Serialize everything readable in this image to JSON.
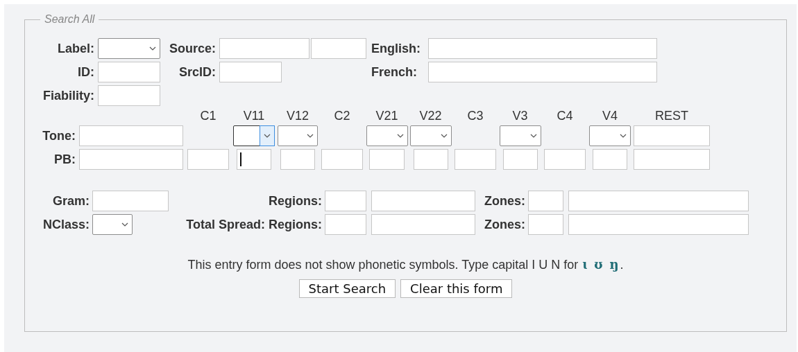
{
  "fieldset": {
    "legend": "Search All"
  },
  "top_rows": [
    {
      "groups": [
        {
          "label": "Label:",
          "fields": [
            {
              "kind": "select",
              "focused": false
            }
          ]
        },
        {
          "label": "Source:",
          "fields": [
            {
              "kind": "text",
              "focused": false
            },
            {
              "kind": "text",
              "focused": false
            }
          ]
        },
        {
          "label": "English:",
          "fields": [
            {
              "kind": "text",
              "focused": false
            }
          ]
        }
      ]
    },
    {
      "groups": [
        {
          "label": "ID:",
          "fields": [
            {
              "kind": "text",
              "focused": false
            }
          ]
        },
        {
          "label": "SrcID:",
          "fields": [
            {
              "kind": "text",
              "focused": false
            }
          ]
        },
        {
          "label": "French:",
          "fields": [
            {
              "kind": "text",
              "focused": false
            }
          ]
        }
      ]
    },
    {
      "groups": [
        {
          "label": "Fiability:",
          "fields": [
            {
              "kind": "text",
              "focused": false
            }
          ]
        }
      ]
    }
  ],
  "phonetic": {
    "tone_label": "Tone:",
    "pb_label": "PB:",
    "columns": [
      {
        "tone": {
          "kind": "text",
          "focused": false
        },
        "pb": {
          "kind": "text",
          "focused": false
        }
      },
      {
        "heading": "C1",
        "pb": {
          "kind": "text",
          "focused": false
        }
      },
      {
        "heading": "V11",
        "tone": {
          "kind": "select",
          "focused": true
        },
        "pb": {
          "kind": "text",
          "focused": true
        }
      },
      {
        "heading": "V12",
        "tone": {
          "kind": "select",
          "focused": false
        },
        "pb": {
          "kind": "text",
          "focused": false
        }
      },
      {
        "heading": "C2",
        "pb": {
          "kind": "text",
          "focused": false
        }
      },
      {
        "heading": "V21",
        "tone": {
          "kind": "select",
          "focused": false
        },
        "pb": {
          "kind": "text",
          "focused": false
        }
      },
      {
        "heading": "V22",
        "tone": {
          "kind": "select",
          "focused": false
        },
        "pb": {
          "kind": "text",
          "focused": false
        }
      },
      {
        "heading": "C3",
        "pb": {
          "kind": "text",
          "focused": false
        }
      },
      {
        "heading": "V3",
        "tone": {
          "kind": "select",
          "focused": false
        },
        "pb": {
          "kind": "text",
          "focused": false
        }
      },
      {
        "heading": "C4",
        "pb": {
          "kind": "text",
          "focused": false
        }
      },
      {
        "heading": "V4",
        "tone": {
          "kind": "select",
          "focused": false
        },
        "pb": {
          "kind": "text",
          "focused": false
        }
      },
      {
        "heading": "REST",
        "tone": {
          "kind": "text",
          "focused": false
        },
        "pb": {
          "kind": "text",
          "focused": false
        }
      }
    ]
  },
  "spread_rows": [
    {
      "label": "Gram:",
      "field": {
        "kind": "text",
        "focused": false
      },
      "regions_label": "Regions:",
      "regions": [
        {
          "kind": "text",
          "focused": false
        },
        {
          "kind": "text",
          "focused": false
        }
      ],
      "zones_label": "Zones:",
      "zones": [
        {
          "kind": "text",
          "focused": false
        },
        {
          "kind": "text",
          "focused": false
        }
      ]
    },
    {
      "label": "NClass:",
      "field": {
        "kind": "select",
        "focused": false
      },
      "regions_label": "Total Spread: Regions:",
      "regions": [
        {
          "kind": "text",
          "focused": false
        },
        {
          "kind": "text",
          "focused": false
        }
      ],
      "zones_label": "Zones:",
      "zones": [
        {
          "kind": "text",
          "focused": false
        },
        {
          "kind": "text",
          "focused": false
        }
      ]
    }
  ],
  "note": {
    "text": "This entry form does not show phonetic symbols. Type capital I U N for",
    "symbols": [
      "ɩ",
      "ʊ",
      "ŋ"
    ],
    "end": "."
  },
  "buttons": [
    "Start Search",
    "Clear this form"
  ]
}
